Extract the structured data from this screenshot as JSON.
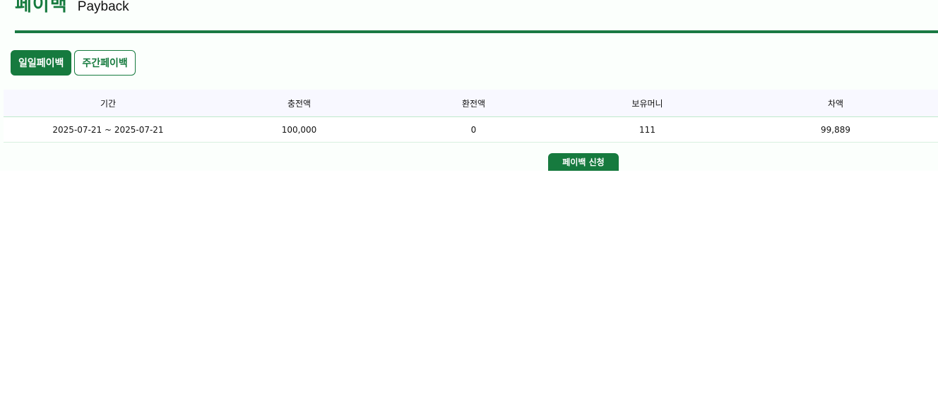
{
  "header": {
    "title_ko": "페이백",
    "title_en": "Payback"
  },
  "tabs": [
    {
      "label": "일일페이백",
      "active": true
    },
    {
      "label": "주간페이백",
      "active": false
    }
  ],
  "table": {
    "columns": [
      "기간",
      "충전액",
      "환전액",
      "보유머니",
      "차액"
    ],
    "rows": [
      [
        "2025-07-21 ~ 2025-07-21",
        "100,000",
        "0",
        "111",
        "99,889"
      ]
    ]
  },
  "actions": {
    "apply_label": "페이백 신청"
  },
  "colors": {
    "accent": "#167a3e",
    "header_bg": "#f8f8ff"
  }
}
